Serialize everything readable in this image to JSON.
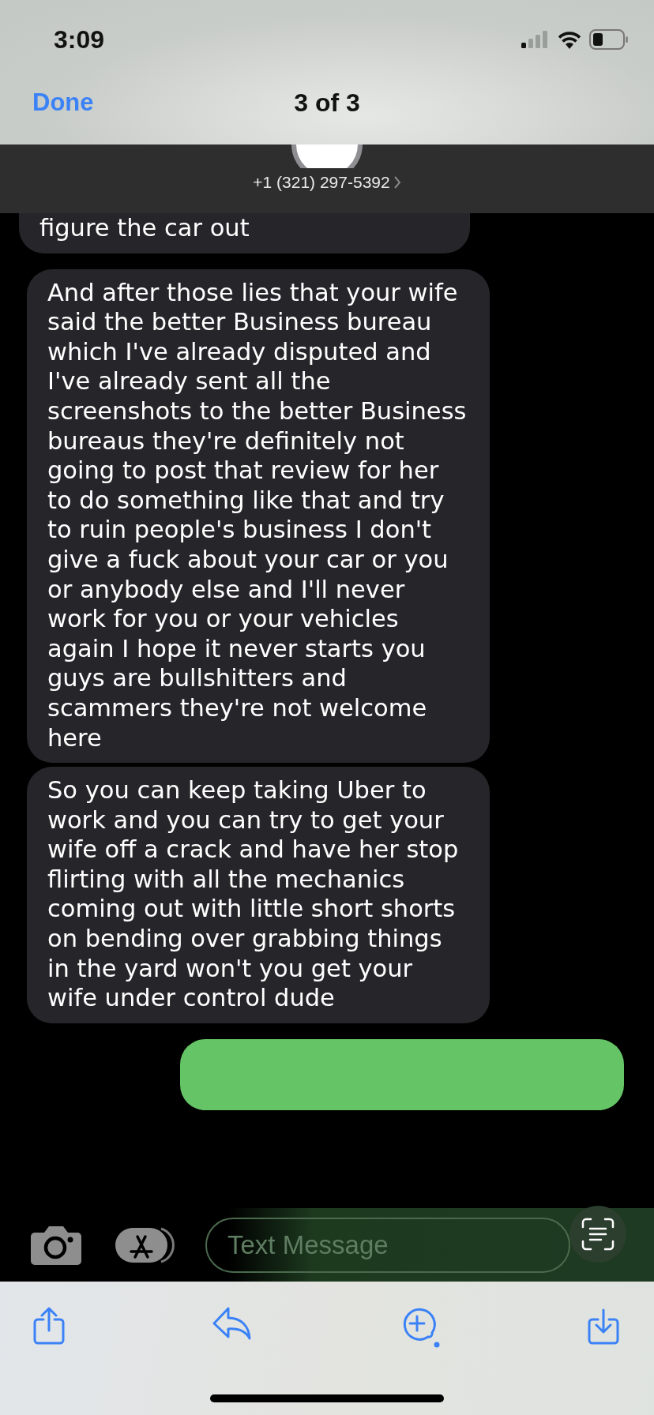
{
  "status_bar": {
    "time": "3:09"
  },
  "nav": {
    "done": "Done",
    "title": "3 of 3"
  },
  "contact": {
    "phone": "+1 (321) 297-5392"
  },
  "messages": [
    {
      "kind": "received",
      "text": "figure the car out"
    },
    {
      "kind": "received",
      "text": "And after those lies that your wife said the better Business bureau which I've already disputed and I've already sent all the screenshots to the better Business bureaus they're definitely not going to post that review for her to do something like that and try to ruin people's business I don't give a fuck about your car or you or anybody else and I'll never work for you or your vehicles again I hope it never starts you guys are bullshitters and scammers they're not welcome here"
    },
    {
      "kind": "received",
      "text": "So you can keep taking Uber to work and you can try to get your wife off a crack and have her stop flirting with all the mechanics coming out with little short shorts on bending over grabbing things in the yard won't you get your wife under control dude"
    },
    {
      "kind": "sent"
    }
  ],
  "composer": {
    "placeholder": "Text Message"
  }
}
